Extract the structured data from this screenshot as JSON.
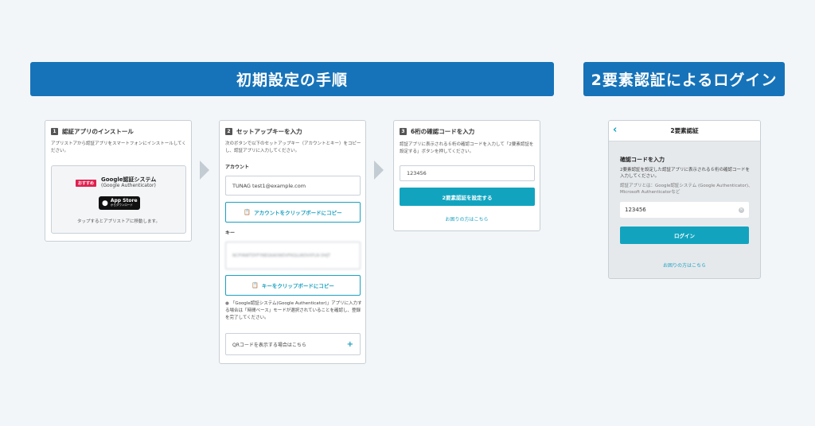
{
  "banners": {
    "setup": "初期設定の手順",
    "login": "2要素認証によるログイン"
  },
  "step1": {
    "num": "1",
    "title": "認証アプリのインストール",
    "desc": "アプリストアから認証アプリをスマートフォンにインストールしてください。",
    "badge": "おすすめ",
    "app_name": "Google認証システム",
    "app_sub": "(Google Authenticator)",
    "store_line1": "App Store",
    "store_line2": "からダウンロード",
    "tap_note": "タップするとアプリストアに移動します。"
  },
  "step2": {
    "num": "2",
    "title": "セットアップキーを入力",
    "desc": "次のボタンで以下のセットアップキー（アカウントとキー）をコピーし、認証アプリに入力してください。",
    "account_label": "アカウント",
    "account_value": "TUNAG test1@example.com",
    "copy_account": "アカウントをクリップボードにコピー",
    "key_label": "キー",
    "key_value": "NCPYAWTDYFYNEGKAOWDVFKQLUKOVXFLN DHJT",
    "copy_key": "キーをクリップボードにコピー",
    "note": "「Google認証システム(Google Authenticator)」アプリに入力する場合は「時間ベース」モードが選択されていることを確認し、登録を完了してください。",
    "qr_text": "QRコードを表示する場合はこちら",
    "qr_plus": "+"
  },
  "step3": {
    "num": "3",
    "title": "6桁の確認コードを入力",
    "desc": "認証アプリに表示される６桁の確認コードを入力して「2要素認証を設定する」ボタンを押してください。",
    "code_value": "123456",
    "submit": "2要素認証を設定する",
    "help": "お困りの方はこちら"
  },
  "login": {
    "header": "2要素認証",
    "title": "確認コードを入力",
    "desc": "2要素認証を設定した認証アプリに表示される６桁の確認コードを入力してください。",
    "desc2": "認証アプリとは：Google認証システム (Google Authenticator)、Microsoft Authenticatorなど",
    "code_value": "123456",
    "login_button": "ログイン",
    "help": "お困りの方はこちら"
  }
}
